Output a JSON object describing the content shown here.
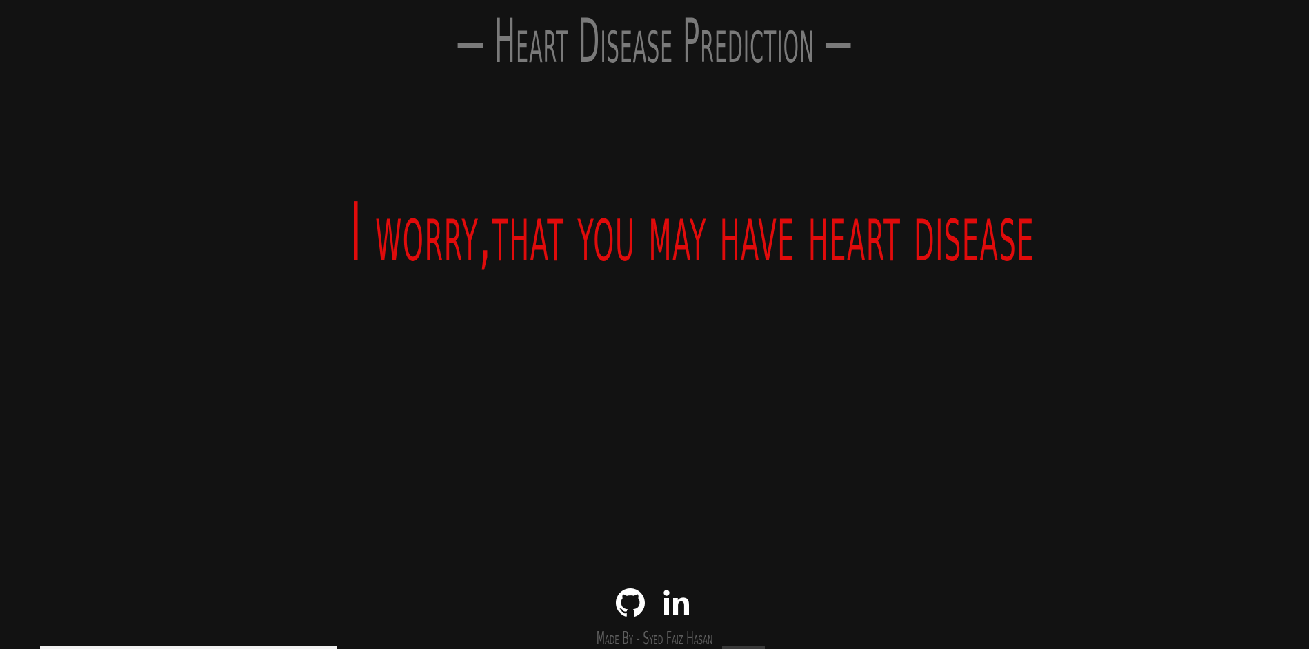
{
  "header": {
    "title": "— Heart Disease Prediction —"
  },
  "result": {
    "message": "I worry,that you may have heart disease"
  },
  "footer": {
    "social": [
      {
        "name": "github",
        "icon": "github-icon"
      },
      {
        "name": "linkedin",
        "icon": "linkedin-icon"
      }
    ],
    "credit": "Made By - Syed Faiz Hasan"
  },
  "colors": {
    "background": "#121212",
    "title": "#7a7a7a",
    "result": "#e00b0b",
    "icons": "#ffffff",
    "credit": "#5e5e5e"
  }
}
